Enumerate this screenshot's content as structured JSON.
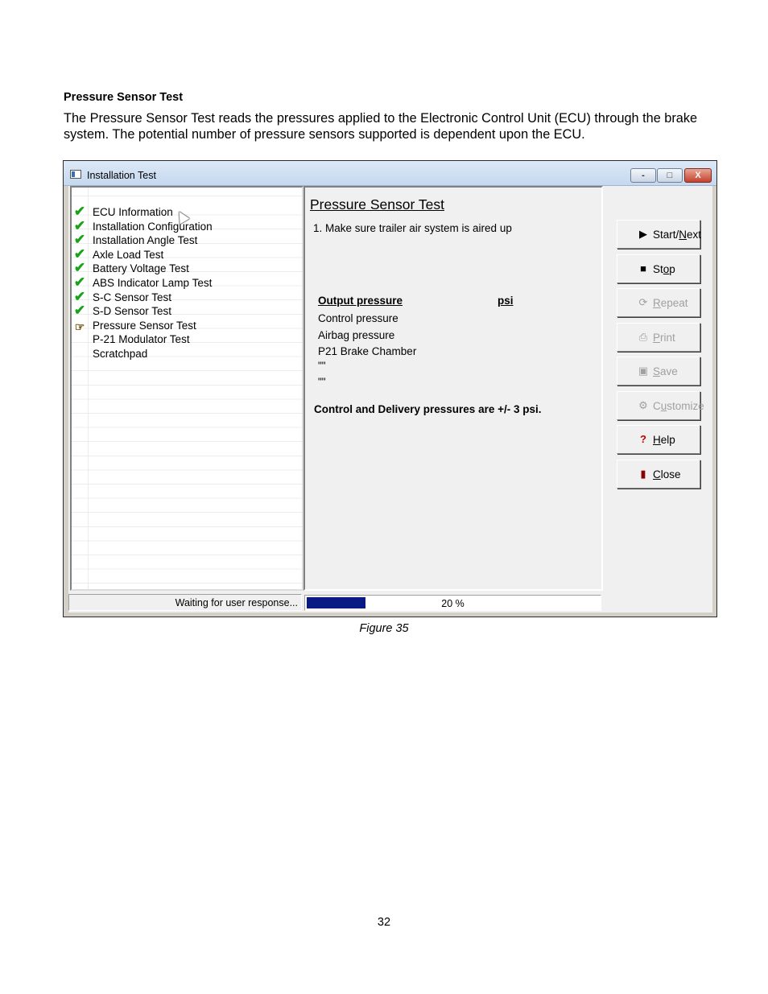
{
  "document": {
    "heading": "Pressure Sensor Test",
    "paragraph": "The Pressure Sensor Test reads the pressures applied to the Electronic Control Unit (ECU) through the brake system. The potential number of pressure sensors supported is dependent upon the ECU.",
    "caption": "Figure 35",
    "page_number": "32"
  },
  "window": {
    "title": "Installation Test",
    "controls": {
      "minimize": "-",
      "maximize": "□",
      "close": "X"
    }
  },
  "test_list": [
    {
      "label": "ECU Information",
      "icon": "check-icon",
      "status": "passed"
    },
    {
      "label": "Installation Configuration",
      "icon": "check-icon",
      "status": "passed"
    },
    {
      "label": "Installation Angle Test",
      "icon": "check-icon",
      "status": "passed"
    },
    {
      "label": "Axle Load Test",
      "icon": "check-icon",
      "status": "passed"
    },
    {
      "label": "Battery Voltage Test",
      "icon": "check-icon",
      "status": "passed"
    },
    {
      "label": "ABS Indicator Lamp Test",
      "icon": "check-icon",
      "status": "passed"
    },
    {
      "label": "S-C Sensor Test",
      "icon": "check-icon",
      "status": "passed"
    },
    {
      "label": "S-D Sensor Test",
      "icon": "check-icon",
      "status": "passed"
    },
    {
      "label": "Pressure Sensor Test",
      "icon": "pointing-hand-icon",
      "status": "current"
    },
    {
      "label": "P-21 Modulator Test",
      "icon": "",
      "status": "pending"
    },
    {
      "label": "Scratchpad",
      "icon": "",
      "status": "pending"
    }
  ],
  "content": {
    "title": "Pressure Sensor Test",
    "step": "1. Make sure trailer air system is aired up",
    "col_output": "Output pressure",
    "col_unit": "psi",
    "rows": [
      "Control pressure",
      "Airbag pressure",
      "P21 Brake Chamber",
      "\"\"",
      "\"\""
    ],
    "note": "Control and Delivery pressures are +/- 3 psi."
  },
  "buttons": [
    {
      "pre": "Start/",
      "u": "N",
      "post": "ext",
      "icon": "play-icon",
      "enabled": true
    },
    {
      "pre": "St",
      "u": "o",
      "post": "p",
      "icon": "stop-icon",
      "enabled": true
    },
    {
      "pre": "",
      "u": "R",
      "post": "epeat",
      "icon": "repeat-icon",
      "enabled": false
    },
    {
      "pre": "",
      "u": "P",
      "post": "rint",
      "icon": "print-icon",
      "enabled": false
    },
    {
      "pre": "",
      "u": "S",
      "post": "ave",
      "icon": "save-icon",
      "enabled": false
    },
    {
      "pre": "C",
      "u": "u",
      "post": "stomize",
      "icon": "customize-icon",
      "enabled": false
    },
    {
      "pre": "",
      "u": "H",
      "post": "elp",
      "icon": "help-icon",
      "enabled": true
    },
    {
      "pre": "",
      "u": "C",
      "post": "lose",
      "icon": "close-door-icon",
      "enabled": true
    }
  ],
  "status": {
    "message": "Waiting for user response...",
    "progress_text": "20 %",
    "progress_fraction": 0.2
  },
  "colors": {
    "progress": "#0a1a84",
    "check": "#1aa31a"
  }
}
